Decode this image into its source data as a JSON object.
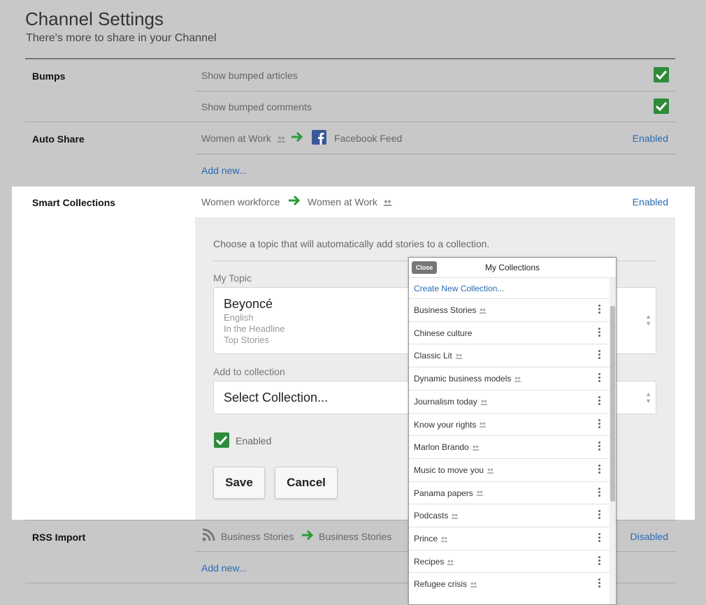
{
  "header": {
    "title": "Channel Settings",
    "subtitle": "There's more to share in your Channel"
  },
  "bumps": {
    "label": "Bumps",
    "articles": "Show bumped articles",
    "comments": "Show bumped comments"
  },
  "auto_share": {
    "label": "Auto Share",
    "source": "Women at Work",
    "target": "Facebook Feed",
    "status": "Enabled",
    "add_new": "Add new..."
  },
  "smart_collections": {
    "label": "Smart Collections",
    "source": "Women workforce",
    "target": "Women at Work",
    "status": "Enabled",
    "description": "Choose a topic that will automatically add stories to a collection.",
    "topic_label": "My Topic",
    "topic_name": "Beyoncé",
    "topic_language": "English",
    "topic_filter": "In the Headline",
    "topic_type": "Top Stories",
    "collection_label": "Add to collection",
    "collection_value": "Select Collection...",
    "enabled_label": "Enabled",
    "save": "Save",
    "cancel": "Cancel"
  },
  "rss_import": {
    "label": "RSS Import",
    "source": "Business Stories",
    "target": "Business Stories",
    "status": "Disabled",
    "add_new": "Add new..."
  },
  "popup": {
    "close": "Close",
    "title": "My Collections",
    "create": "Create New Collection...",
    "items": [
      "Business Stories",
      "Chinese culture",
      "Classic Lit",
      "Dynamic business models",
      "Journalism today",
      "Know your rights",
      "Marlon Brando",
      "Music to move you",
      "Panama papers",
      "Podcasts",
      "Prince",
      "Recipes",
      "Refugee crisis"
    ]
  },
  "colors": {
    "accent": "#2a6ab5",
    "check": "#2e8b3a"
  }
}
